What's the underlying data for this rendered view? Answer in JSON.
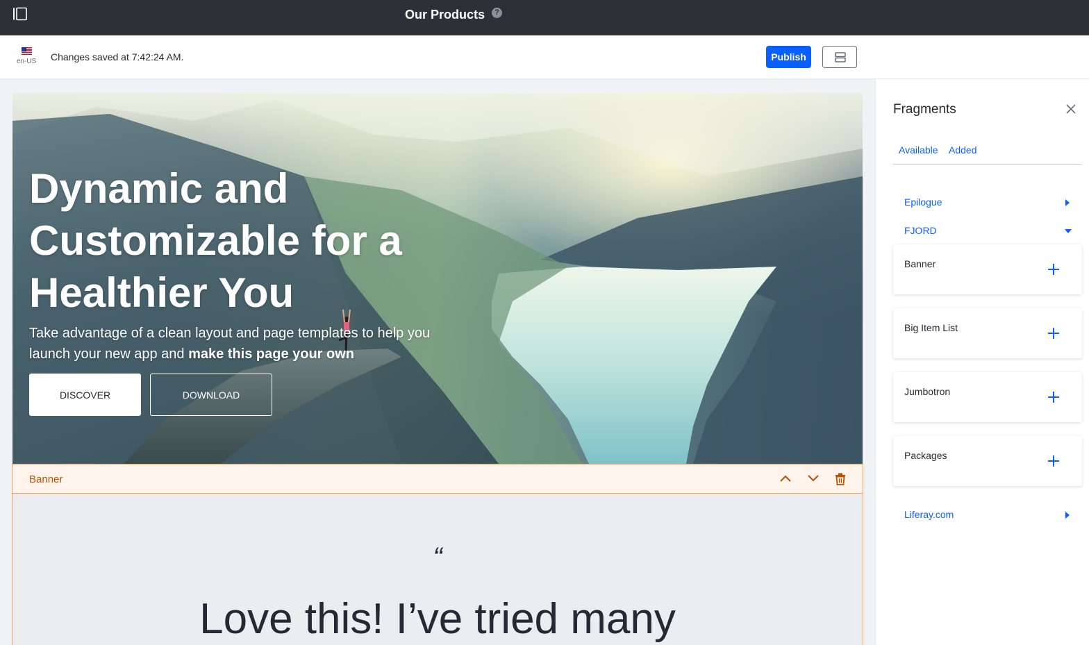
{
  "header": {
    "title": "Our Products",
    "help_icon": "?"
  },
  "toolbar": {
    "language_code": "en-US",
    "save_status": "Changes saved at 7:42:24 AM.",
    "publish_label": "Publish"
  },
  "hero": {
    "title": "Dynamic and Customizable for a Healthier You",
    "subtitle_plain": "Take advantage of a clean layout and page templates to help you launch your new app and ",
    "subtitle_bold": "make this page your own",
    "discover_label": "DISCOVER",
    "download_label": "DOWNLOAD"
  },
  "selected_fragment": {
    "label": "Banner"
  },
  "testimonial": {
    "quote_mark": "“",
    "text": "Love this! I’ve tried many"
  },
  "panel": {
    "title": "Fragments",
    "tabs": [
      {
        "label": "Available"
      },
      {
        "label": "Added"
      }
    ],
    "collections": [
      {
        "label": "Epilogue",
        "state": "collapsed"
      },
      {
        "label": "FJORD",
        "state": "expanded"
      },
      {
        "label": "Liferay.com",
        "state": "collapsed"
      }
    ],
    "fragments": [
      {
        "name": "Banner"
      },
      {
        "name": "Big Item List"
      },
      {
        "name": "Jumbotron"
      },
      {
        "name": "Packages"
      }
    ]
  },
  "colors": {
    "topbar": "#2f2f38",
    "accent": "#0b5fff",
    "fragment_highlight": "#f2a254",
    "fragment_label": "#b95000"
  }
}
